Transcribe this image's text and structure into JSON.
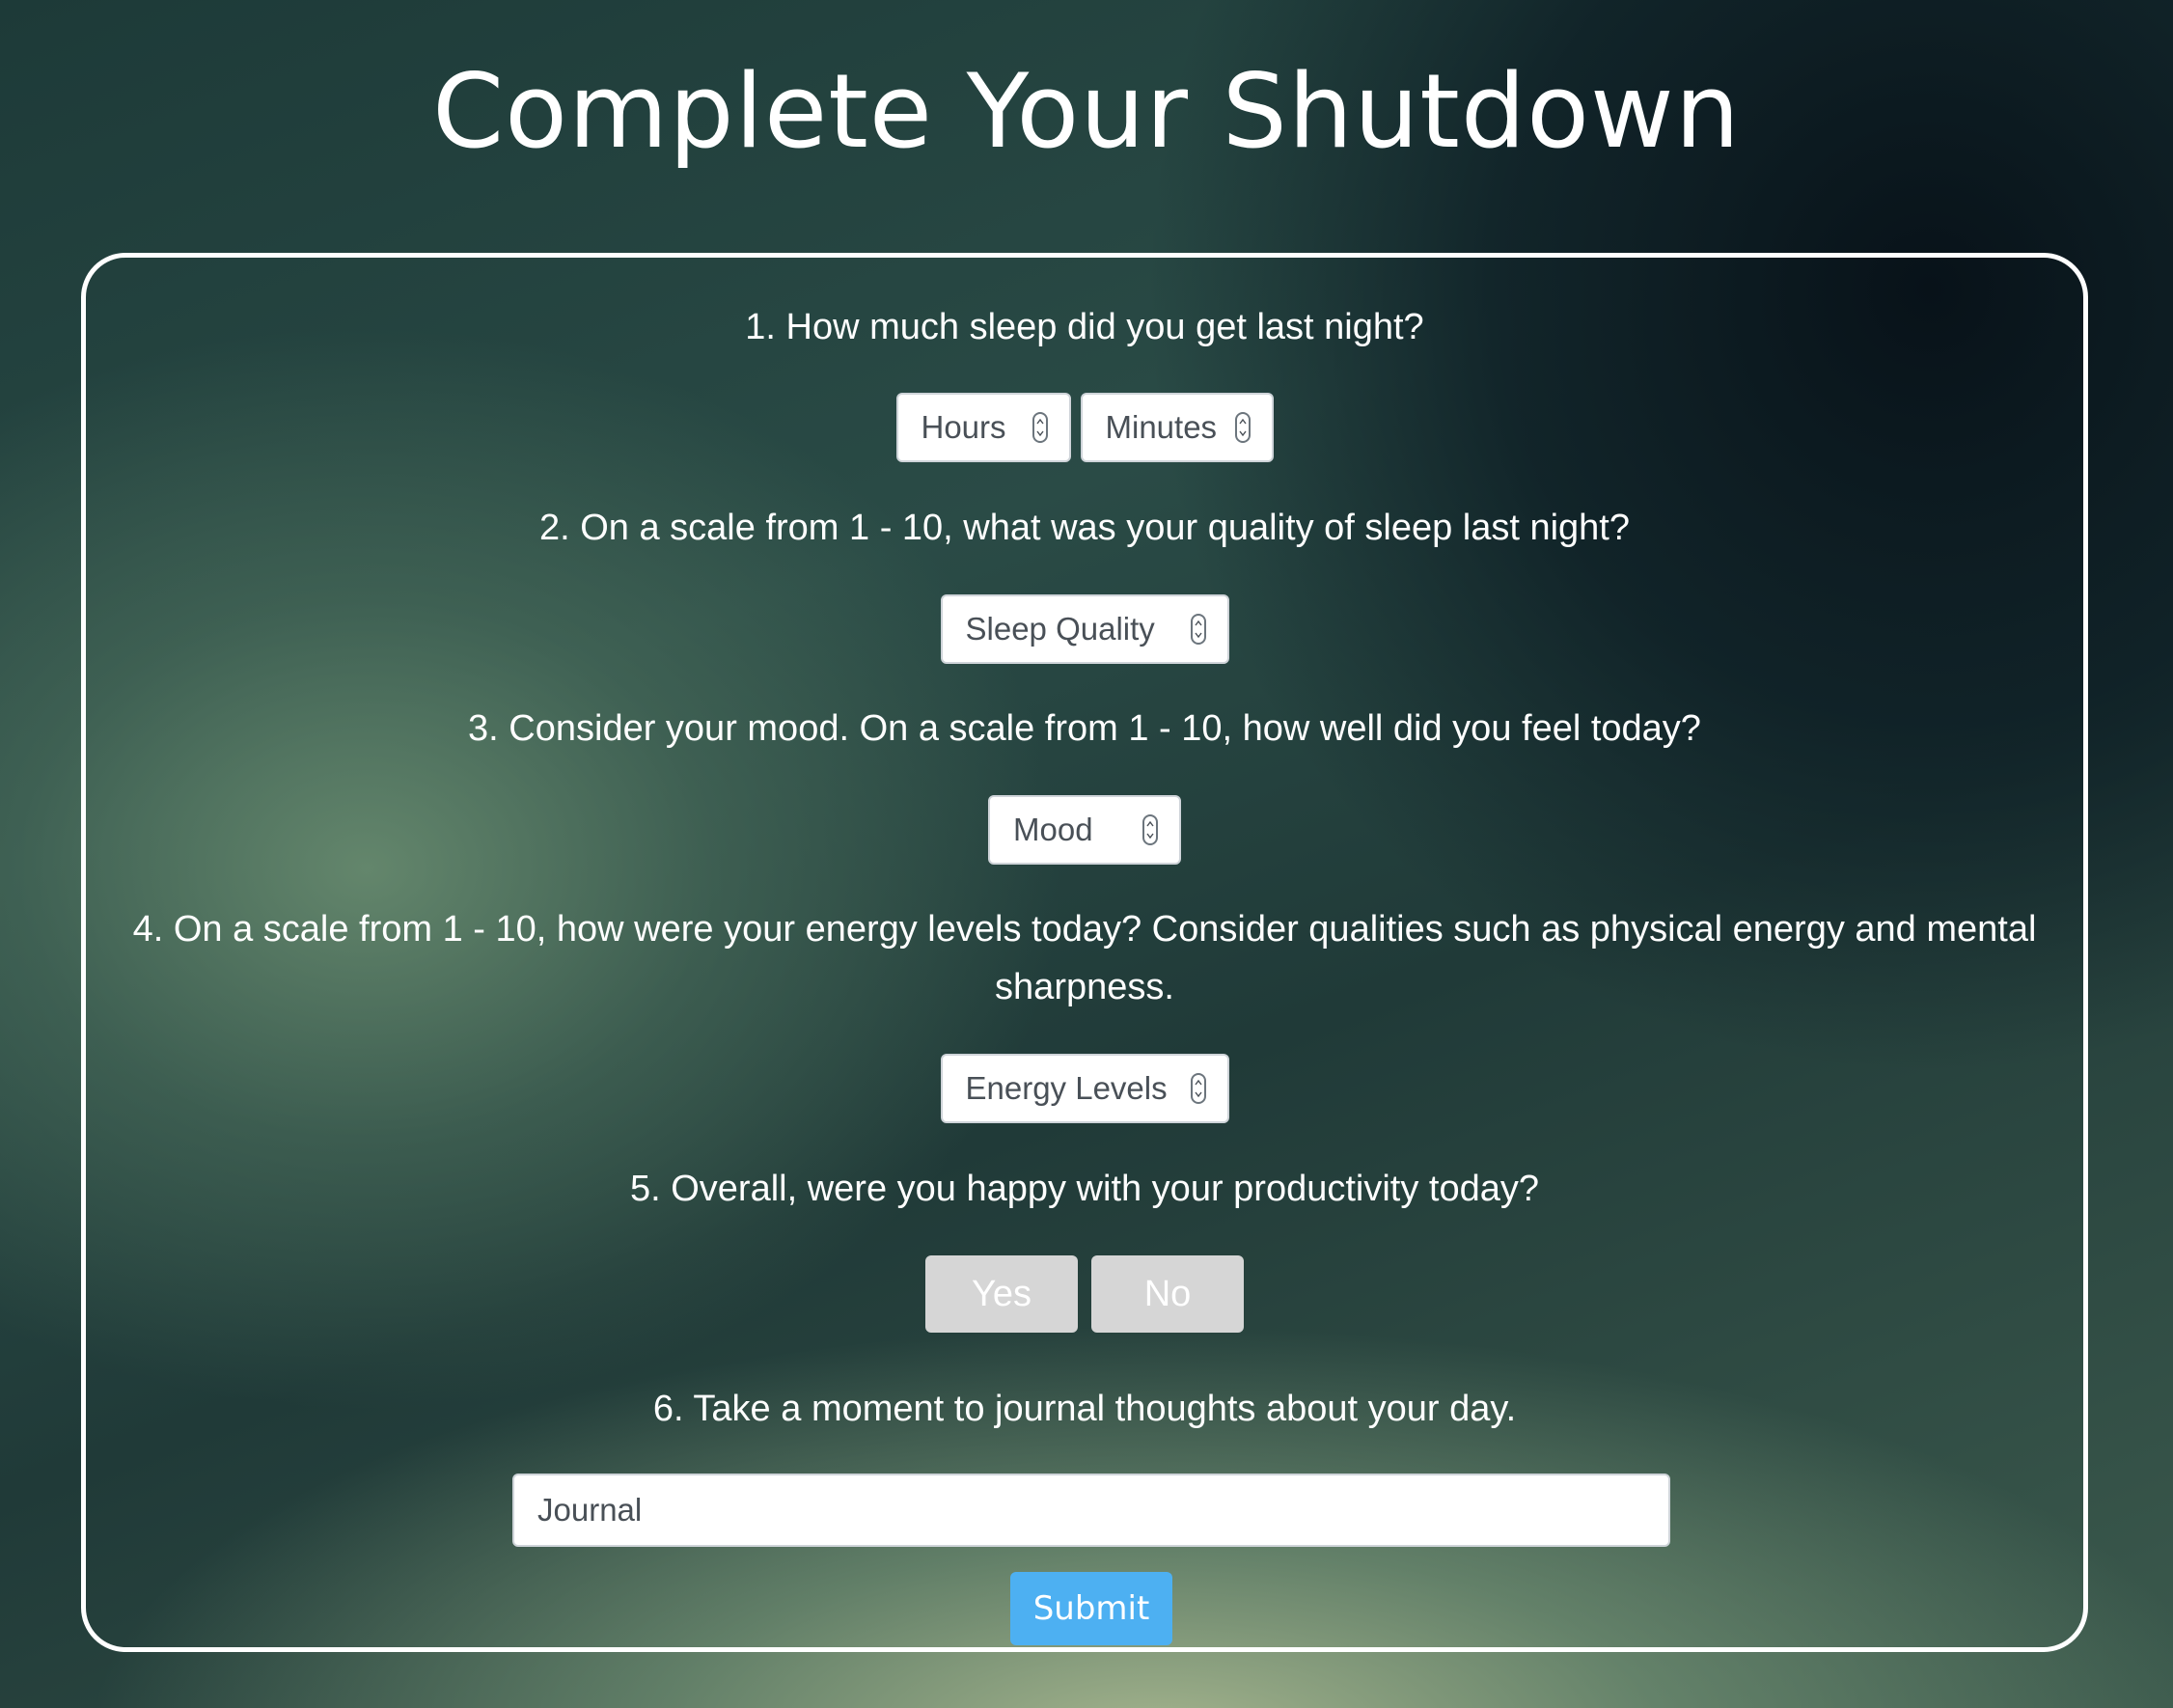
{
  "page": {
    "title": "Complete Your Shutdown"
  },
  "form": {
    "q1": {
      "label": "1. How much sleep did you get last night?",
      "hours_placeholder": "Hours",
      "minutes_placeholder": "Minutes"
    },
    "q2": {
      "label": "2. On a scale from 1 - 10, what was your quality of sleep last night?",
      "placeholder": "Sleep Quality"
    },
    "q3": {
      "label": "3. Consider your mood. On a scale from 1 - 10, how well did you feel today?",
      "placeholder": "Mood"
    },
    "q4": {
      "label": "4. On a scale from 1 - 10, how were your energy levels today? Consider qualities such as physical energy and mental sharpness.",
      "placeholder": "Energy Levels"
    },
    "q5": {
      "label": "5. Overall, were you happy with your productivity today?",
      "yes_label": "Yes",
      "no_label": "No"
    },
    "q6": {
      "label": "6. Take a moment to journal thoughts about your day.",
      "placeholder": "Journal"
    },
    "submit_label": "Submit"
  },
  "colors": {
    "submit": "#4db0f2",
    "toggle_button": "#d6d6d6",
    "card_border": "#ffffff"
  },
  "icons": {
    "spinner": "spinner-arrows-icon"
  }
}
